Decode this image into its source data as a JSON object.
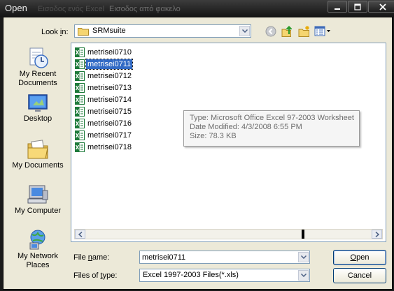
{
  "window": {
    "title": "Open",
    "ghost_tab_1": "Εισοδος ενός Excel",
    "ghost_tab_2": "Εισοδος από φακελο",
    "buttons": [
      "minimize",
      "maximize",
      "close"
    ]
  },
  "lookin": {
    "label_prefix": "Look ",
    "label_underlined": "i",
    "label_suffix": "n:",
    "value": "SRMsuite"
  },
  "toolbar_icons": [
    "back-icon",
    "up-folder-icon",
    "new-folder-icon",
    "views-menu-icon"
  ],
  "places": [
    {
      "label_line1": "My Recent",
      "label_line2": "Documents",
      "icon": "recent-documents-icon"
    },
    {
      "label_line1": "Desktop",
      "label_line2": "",
      "icon": "desktop-icon"
    },
    {
      "label_line1": "My Documents",
      "label_line2": "",
      "icon": "my-documents-icon"
    },
    {
      "label_line1": "My Computer",
      "label_line2": "",
      "icon": "my-computer-icon"
    },
    {
      "label_line1": "My Network",
      "label_line2": "Places",
      "icon": "network-places-icon"
    }
  ],
  "files": [
    {
      "name": "metrisei0710",
      "selected": false
    },
    {
      "name": "metrisei0711",
      "selected": true
    },
    {
      "name": "metrisei0712",
      "selected": false
    },
    {
      "name": "metrisei0713",
      "selected": false
    },
    {
      "name": "metrisei0714",
      "selected": false
    },
    {
      "name": "metrisei0715",
      "selected": false
    },
    {
      "name": "metrisei0716",
      "selected": false
    },
    {
      "name": "metrisei0717",
      "selected": false
    },
    {
      "name": "metrisei0718",
      "selected": false
    }
  ],
  "tooltip": {
    "type_line": "Type: Microsoft Office Excel 97-2003 Worksheet",
    "modified_line": "Date Modified: 4/3/2008 6:55 PM",
    "size_line": "Size: 78.3 KB"
  },
  "filename": {
    "label_prefix": "File ",
    "label_underlined": "n",
    "label_suffix": "ame:",
    "value": "metrisei0711"
  },
  "filetype": {
    "label_prefix": "Files of ",
    "label_underlined": "t",
    "label_suffix": "ype:",
    "value": "Excel 1997-2003 Files(*.xls)"
  },
  "buttons": {
    "open_underlined": "O",
    "open_rest": "pen",
    "cancel": "Cancel"
  },
  "colors": {
    "selection": "#316ac5",
    "dialog_bg": "#ece9d8",
    "excel_green": "#1d7a3a"
  }
}
